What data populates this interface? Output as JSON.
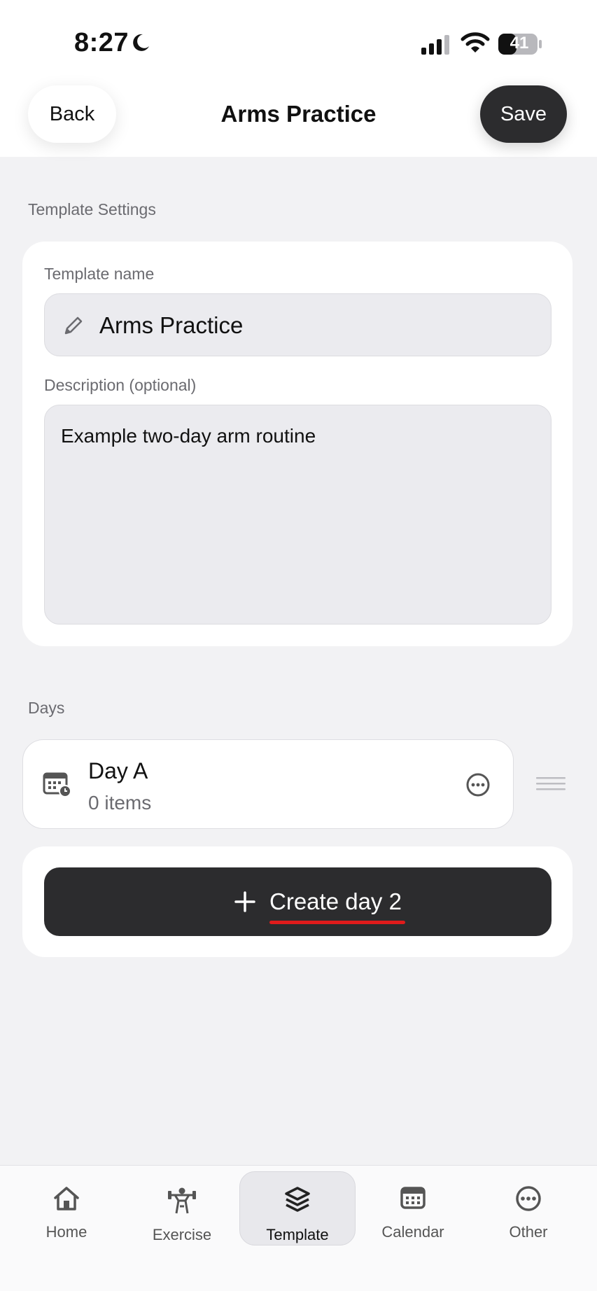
{
  "status_bar": {
    "time": "8:27",
    "battery": "41"
  },
  "header": {
    "back_label": "Back",
    "title": "Arms Practice",
    "save_label": "Save"
  },
  "settings": {
    "section_label": "Template Settings",
    "name_label": "Template name",
    "name_value": "Arms Practice",
    "description_label": "Description (optional)",
    "description_value": "Example two-day arm routine"
  },
  "days": {
    "section_label": "Days",
    "items": [
      {
        "name": "Day A",
        "count": "0 items"
      }
    ],
    "create_label": "Create day 2"
  },
  "tabs": [
    {
      "label": "Home",
      "icon": "home-icon"
    },
    {
      "label": "Exercise",
      "icon": "weightlifter-icon"
    },
    {
      "label": "Template",
      "icon": "layers-icon",
      "active": true
    },
    {
      "label": "Calendar",
      "icon": "calendar-icon"
    },
    {
      "label": "Other",
      "icon": "more-icon"
    }
  ],
  "colors": {
    "accent_dark": "#2c2c2e",
    "underline_red": "#e01b1b",
    "background": "#f2f2f4"
  }
}
